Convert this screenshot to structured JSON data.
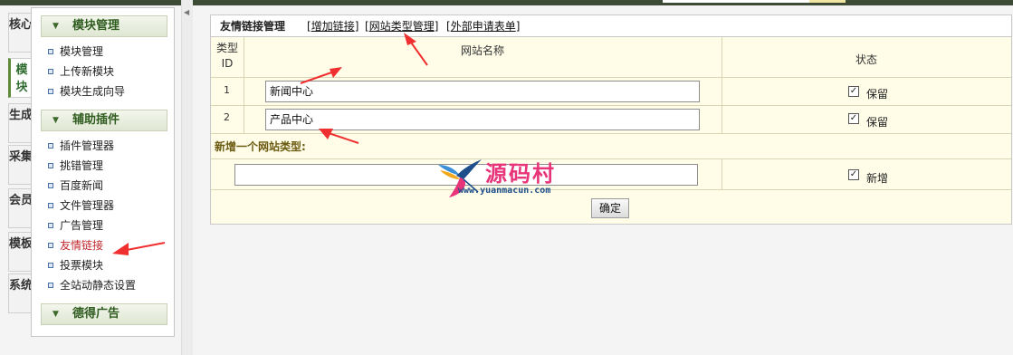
{
  "vtabs": [
    {
      "label": "核心",
      "active": false
    },
    {
      "label": "模块",
      "active": true
    },
    {
      "label": "生成",
      "active": false
    },
    {
      "label": "采集",
      "active": false
    },
    {
      "label": "会员",
      "active": false
    },
    {
      "label": "模板",
      "active": false
    },
    {
      "label": "系统",
      "active": false
    }
  ],
  "sidebar": {
    "sections": [
      {
        "title": "模块管理",
        "items": [
          "模块管理",
          "上传新模块",
          "模块生成向导"
        ]
      },
      {
        "title": "辅助插件",
        "items": [
          "插件管理器",
          "挑错管理",
          "百度新闻",
          "文件管理器",
          "广告管理",
          "友情链接",
          "投票模块",
          "全站动静态设置"
        ]
      },
      {
        "title": "德得广告",
        "items": []
      }
    ],
    "active_item": "友情链接"
  },
  "page": {
    "title": "友情链接管理",
    "links": [
      "增加链接",
      "网站类型管理",
      "外部申请表单"
    ]
  },
  "table": {
    "headers": {
      "id": "类型ID",
      "name": "网站名称",
      "status": "状态"
    },
    "rows": [
      {
        "id": "1",
        "name": "新闻中心",
        "checked": true,
        "status_label": "保留"
      },
      {
        "id": "2",
        "name": "产品中心",
        "checked": true,
        "status_label": "保留"
      }
    ],
    "new_section_label": "新增一个网站类型:",
    "new_row": {
      "name": "",
      "checked": true,
      "status_label": "新增"
    },
    "confirm_label": "确定"
  },
  "watermark": {
    "brand": "源码村",
    "url": "www.yuanmacun.com"
  },
  "colors": {
    "accent_green": "#2f5c1f",
    "active_red": "#c0272d",
    "annotation_arrow": "#f03030",
    "panel_bg": "#fffde8"
  }
}
